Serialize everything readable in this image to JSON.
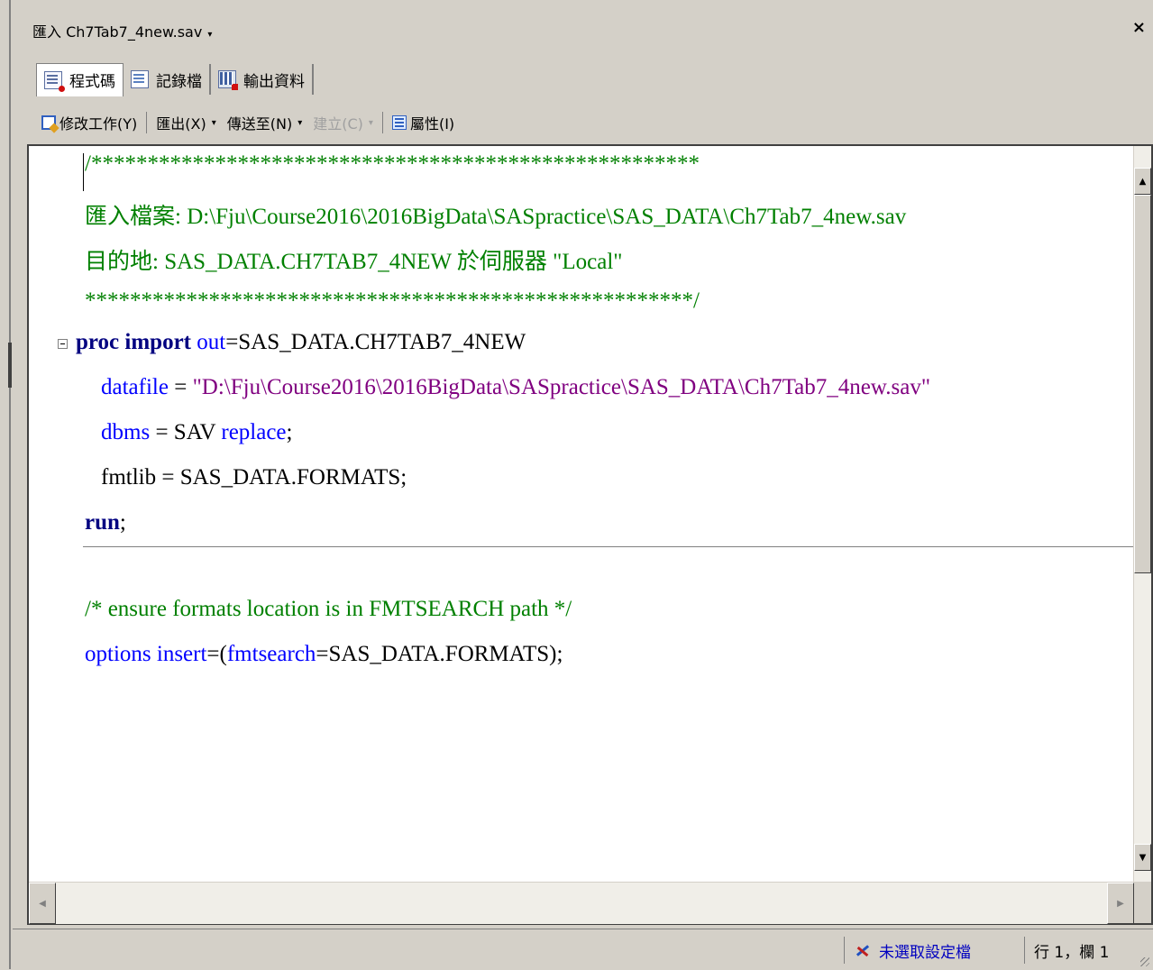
{
  "window": {
    "title": "匯入 Ch7Tab7_4new.sav",
    "title_caret": "▾",
    "close_symbol": "×"
  },
  "tabs": [
    {
      "label": "程式碼",
      "icon": "code-icon",
      "active": true
    },
    {
      "label": "記錄檔",
      "icon": "log-icon",
      "active": false
    },
    {
      "label": "輸出資料",
      "icon": "output-data-icon",
      "active": false
    }
  ],
  "toolbar": {
    "modify_task": "修改工作(Y)",
    "export": "匯出(X)",
    "send_to": "傳送至(N)",
    "create": "建立(C)",
    "properties": "屬性(I)",
    "caret": "▾"
  },
  "code": {
    "line1": "/******************************************************",
    "line2": "匯入檔案: D:\\Fju\\Course2016\\2016BigData\\SASpractice\\SAS_DATA\\Ch7Tab7_4new.sav",
    "line3": "目的地: SAS_DATA.CH7TAB7_4NEW 於伺服器 \"Local\"",
    "line4": "******************************************************/",
    "line5_kw": "proc import",
    "line5_opt": "out",
    "line5_rest": "=SAS_DATA.CH7TAB7_4NEW",
    "line6_opt": "datafile",
    "line6_eq": " = ",
    "line6_str": "\"D:\\Fju\\Course2016\\2016BigData\\SASpractice\\SAS_DATA\\Ch7Tab7_4new.sav\"",
    "line7_opt": "dbms",
    "line7_mid": " = SAV ",
    "line7_rep": "replace",
    "line7_end": ";",
    "line8": "fmtlib = SAS_DATA.FORMATS;",
    "line9_kw": "run",
    "line9_end": ";",
    "line10": "/* ensure formats location is in FMTSEARCH path */",
    "line11_kw": "options",
    "line11_opt": "insert",
    "line11_mid": "=(",
    "line11_opt2": "fmtsearch",
    "line11_end": "=SAS_DATA.FORMATS);"
  },
  "status": {
    "profile": "未選取設定檔",
    "position": "行 1，欄 1"
  },
  "colors": {
    "comment": "#008000",
    "keyword": "#000080",
    "option": "#0000ff",
    "string": "#800080",
    "chrome": "#d4d0c8"
  }
}
